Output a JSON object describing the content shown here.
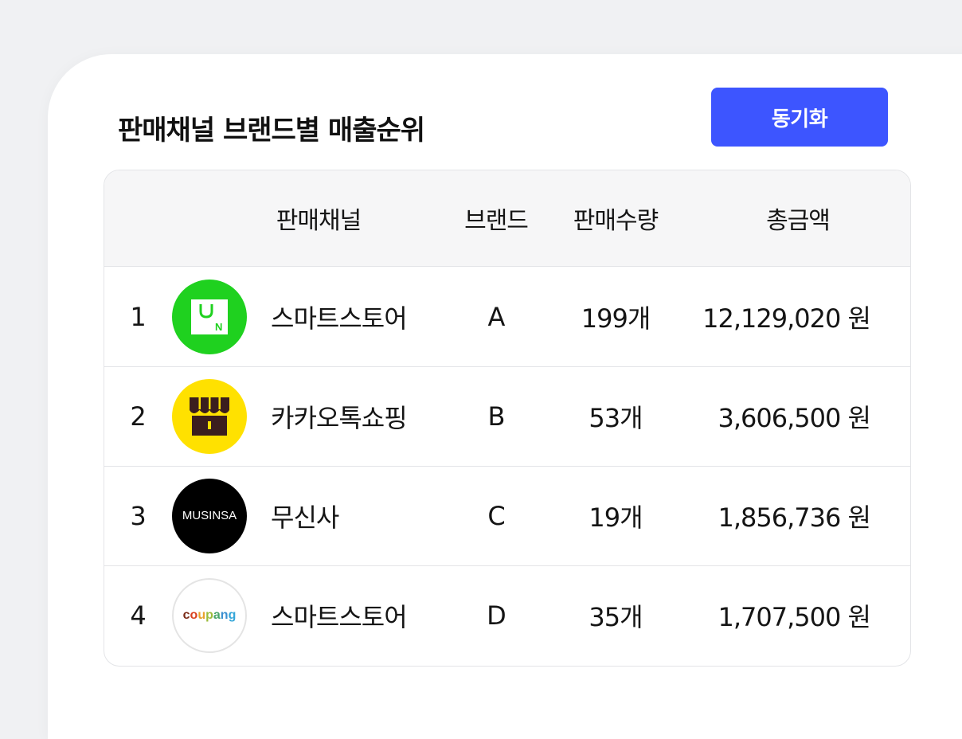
{
  "header": {
    "title": "판매채널 브랜드별 매출순위",
    "sync_label": "동기화"
  },
  "table": {
    "columns": {
      "channel": "판매채널",
      "brand": "브랜드",
      "quantity": "판매수량",
      "total": "총금액"
    },
    "rows": [
      {
        "rank": "1",
        "logo": "naver-smartstore-logo",
        "channel": "스마트스토어",
        "brand": "A",
        "quantity": "199개",
        "total": "12,129,020 원"
      },
      {
        "rank": "2",
        "logo": "kakao-shopping-logo",
        "channel": "카카오톡쇼핑",
        "brand": "B",
        "quantity": "53개",
        "total": "3,606,500 원"
      },
      {
        "rank": "3",
        "logo": "musinsa-logo",
        "logo_text": "MUSINSA",
        "channel": "무신사",
        "brand": "C",
        "quantity": "19개",
        "total": "1,856,736 원"
      },
      {
        "rank": "4",
        "logo": "coupang-logo",
        "logo_text": "coupang",
        "channel": "스마트스토어",
        "brand": "D",
        "quantity": "35개",
        "total": "1,707,500 원"
      }
    ]
  },
  "colors": {
    "accent": "#3d55ff",
    "naver_green": "#1fd11f",
    "kakao_yellow": "#ffe100",
    "musinsa_black": "#000000"
  }
}
